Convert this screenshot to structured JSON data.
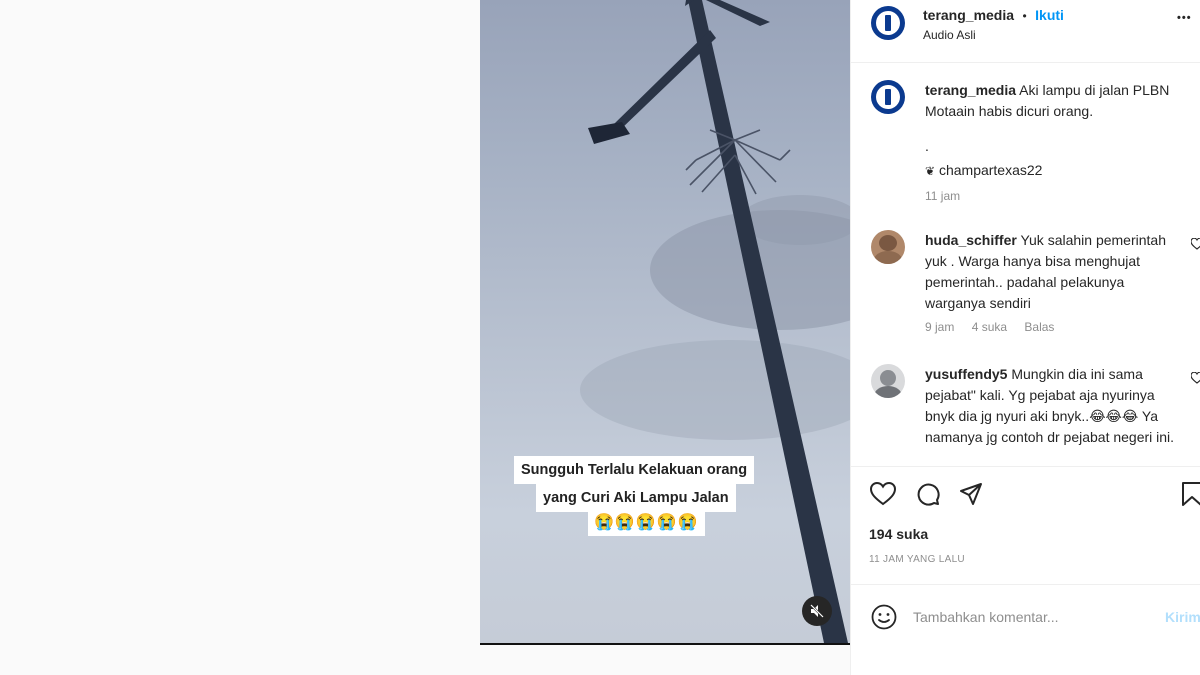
{
  "post": {
    "username": "terang_media",
    "separator": "•",
    "follow_label": "Ikuti",
    "audio": "Audio Asli",
    "more_label": "•••"
  },
  "video": {
    "caption_line1": "Sungguh Terlalu Kelakuan orang",
    "caption_line2": "yang Curi Aki Lampu Jalan",
    "caption_emoji": "😭😭😭😭😭"
  },
  "caption": {
    "username": "terang_media",
    "text": "Aki lampu di jalan PLBN Motaain habis dicuri orang.",
    "dot": ".",
    "music": "champartexas22",
    "time": "11 jam"
  },
  "comments": [
    {
      "username": "huda_schiffer",
      "text": "Yuk salahin pemerintah yuk . Warga hanya bisa menghujat pemerintah.. padahal pelakunya warganya sendiri",
      "time": "9 jam",
      "likes": "4 suka",
      "reply": "Balas"
    },
    {
      "username": "yusuffendy5",
      "text": "Mungkin dia ini sama pejabat\" kali. Yg pejabat aja nyurinya bnyk dia jg nyuri aki bnyk..😂😂😂 Ya namanya jg contoh dr pejabat negeri ini."
    }
  ],
  "likes": "194 suka",
  "time_ago": "11 JAM YANG LALU",
  "comment_box": {
    "placeholder": "Tambahkan komentar...",
    "post_label": "Kirim"
  },
  "colors": {
    "accent": "#0095f6",
    "brand_avatar": "#0b3a8f"
  }
}
